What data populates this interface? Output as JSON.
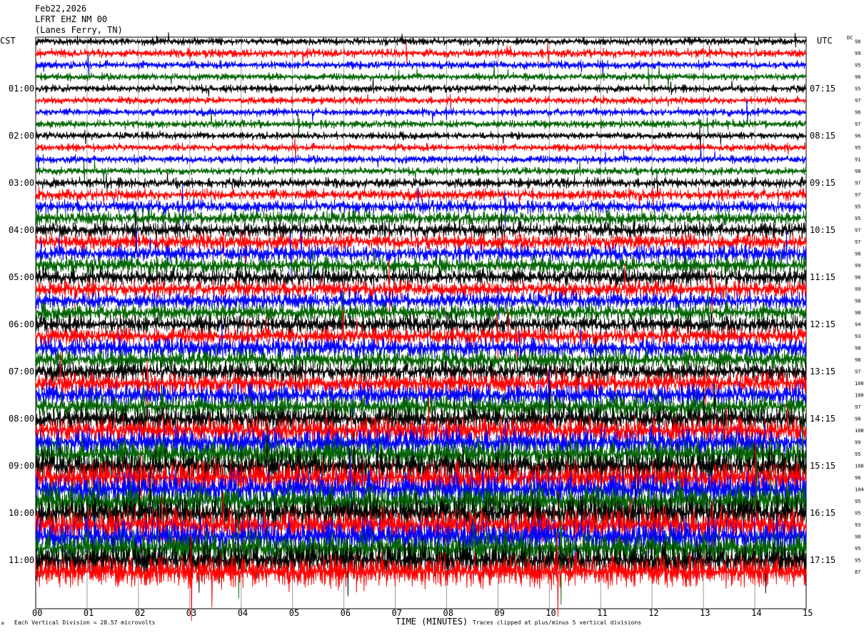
{
  "header": {
    "date": "Feb22,2026",
    "station": "LFRT EHZ NM 00",
    "location": "(Lanes Ferry, TN)"
  },
  "left_tz": "CST",
  "right_tz": "UTC",
  "dc_header": "DC",
  "footer": {
    "scale_note": "Each Vertical Division = 28.57 microvolts",
    "clip_note": "Traces clipped at plus/minus 5 vertical divisions",
    "corner_mark": "M"
  },
  "colors": {
    "black": "#000000",
    "red": "#ff0000",
    "blue": "#0000ff",
    "green": "#006400",
    "grid": "#9a9a9a"
  },
  "chart_data": {
    "type": "line",
    "title": "LFRT EHZ NM 00",
    "xlabel": "TIME (MINUTES)",
    "ylabel": "",
    "x_ticks": [
      "00",
      "01",
      "02",
      "03",
      "04",
      "05",
      "06",
      "07",
      "08",
      "09",
      "10",
      "11",
      "12",
      "13",
      "14",
      "15"
    ],
    "xlim": [
      0,
      15
    ],
    "trace_colors_cycle": [
      "black",
      "red",
      "blue",
      "green"
    ],
    "left_hour_labels": [
      "01:00",
      "02:00",
      "03:00",
      "04:00",
      "05:00",
      "06:00",
      "07:00",
      "08:00",
      "09:00",
      "10:00",
      "11:00"
    ],
    "right_hour_labels": [
      "07:15",
      "08:15",
      "09:15",
      "10:15",
      "11:15",
      "12:15",
      "13:15",
      "14:15",
      "15:15",
      "16:15",
      "17:15"
    ],
    "dc_offsets": [
      98,
      99,
      95,
      96,
      95,
      97,
      96,
      97,
      96,
      95,
      91,
      98,
      97,
      97,
      95,
      95,
      97,
      97,
      98,
      99,
      96,
      99,
      98,
      98,
      94,
      93,
      98,
      98,
      97,
      100,
      100,
      97,
      98,
      108,
      99,
      95,
      108,
      96,
      104,
      95,
      95,
      93,
      98,
      95,
      95,
      87
    ],
    "trace_amplitude": [
      1.2,
      1.4,
      1.3,
      1.2,
      1.2,
      1.2,
      1.2,
      1.3,
      1.2,
      1.2,
      1.3,
      1.2,
      1.6,
      1.8,
      2.0,
      2.2,
      2.4,
      2.6,
      2.6,
      2.6,
      2.6,
      2.6,
      2.6,
      2.8,
      2.8,
      2.8,
      3.0,
      3.0,
      3.0,
      3.2,
      3.4,
      3.6,
      3.8,
      4.0,
      4.2,
      4.4,
      4.6,
      4.8,
      5.0,
      5.0,
      5.0,
      5.0,
      5.0,
      5.0,
      5.0,
      5.0
    ]
  }
}
